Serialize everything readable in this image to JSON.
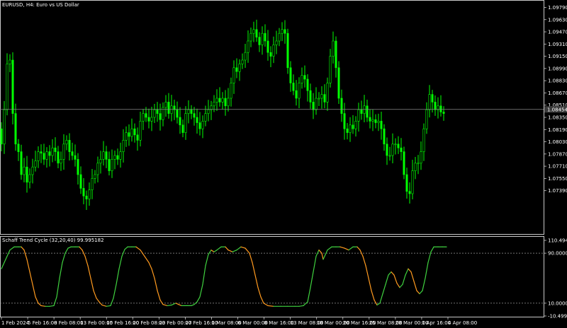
{
  "chart_data": [
    {
      "type": "candlestick",
      "symbol": "EURUSD",
      "timeframe": "H4",
      "title": "EURUSD, H4:  Euro vs US Dollar",
      "ylim": [
        1.0685,
        1.0985
      ],
      "y_ticks": [
        "1.09790",
        "1.09630",
        "1.09470",
        "1.09310",
        "1.09150",
        "1.08990",
        "1.08830",
        "1.08670",
        "1.08510",
        "1.08350",
        "1.08190",
        "1.08030",
        "1.07870",
        "1.07710",
        "1.07550",
        "1.07390"
      ],
      "current_price": 1.08454,
      "current_price_label": "1.08454",
      "x_ticks": [
        "1 Feb 2024",
        "5 Feb 16:00",
        "8 Feb 08:00",
        "13 Feb 00:00",
        "15 Feb 16:00",
        "20 Feb 08:00",
        "23 Feb 00:00",
        "27 Feb 16:00",
        "1 Mar 08:00",
        "6 Mar 00:00",
        "8 Mar 16:00",
        "13 Mar 08:00",
        "18 Mar 00:00",
        "20 Mar 16:00",
        "25 Mar 08:00",
        "28 Mar 00:00",
        "1 Apr 16:00",
        "4 Apr 08:00"
      ],
      "candle_color": "#00ff00",
      "close_path": [
        [
          0,
          1.082
        ],
        [
          4,
          1.08
        ],
        [
          8,
          1.0845
        ],
        [
          12,
          1.0905
        ],
        [
          16,
          1.091
        ],
        [
          20,
          1.084
        ],
        [
          24,
          1.08
        ],
        [
          28,
          1.079
        ],
        [
          32,
          1.076
        ],
        [
          36,
          1.077
        ],
        [
          40,
          1.075
        ],
        [
          44,
          1.076
        ],
        [
          48,
          1.077
        ],
        [
          52,
          1.0778
        ],
        [
          56,
          1.079
        ],
        [
          60,
          1.0788
        ],
        [
          64,
          1.078
        ],
        [
          68,
          1.079
        ],
        [
          72,
          1.0785
        ],
        [
          76,
          1.0795
        ],
        [
          80,
          1.079
        ],
        [
          84,
          1.0775
        ],
        [
          88,
          1.078
        ],
        [
          92,
          1.08
        ],
        [
          96,
          1.0805
        ],
        [
          100,
          1.079
        ],
        [
          104,
          1.0785
        ],
        [
          108,
          1.078
        ],
        [
          112,
          1.076
        ],
        [
          116,
          1.0742
        ],
        [
          120,
          1.0732
        ],
        [
          124,
          1.0728
        ],
        [
          128,
          1.074
        ],
        [
          132,
          1.0755
        ],
        [
          136,
          1.076
        ],
        [
          140,
          1.0775
        ],
        [
          144,
          1.078
        ],
        [
          148,
          1.079
        ],
        [
          152,
          1.078
        ],
        [
          156,
          1.0765
        ],
        [
          160,
          1.078
        ],
        [
          164,
          1.0785
        ],
        [
          168,
          1.078
        ],
        [
          172,
          1.079
        ],
        [
          176,
          1.0805
        ],
        [
          180,
          1.0815
        ],
        [
          184,
          1.081
        ],
        [
          188,
          1.082
        ],
        [
          192,
          1.0812
        ],
        [
          196,
          1.0805
        ],
        [
          200,
          1.083
        ],
        [
          204,
          1.084
        ],
        [
          208,
          1.0835
        ],
        [
          212,
          1.083
        ],
        [
          216,
          1.0835
        ],
        [
          220,
          1.0845
        ],
        [
          224,
          1.084
        ],
        [
          228,
          1.0832
        ],
        [
          232,
          1.0848
        ],
        [
          236,
          1.0855
        ],
        [
          240,
          1.084
        ],
        [
          244,
          1.085
        ],
        [
          248,
          1.0845
        ],
        [
          252,
          1.0835
        ],
        [
          256,
          1.0825
        ],
        [
          260,
          1.0815
        ],
        [
          264,
          1.084
        ],
        [
          268,
          1.0845
        ],
        [
          272,
          1.084
        ],
        [
          276,
          1.0835
        ],
        [
          280,
          1.0828
        ],
        [
          284,
          1.082
        ],
        [
          288,
          1.083
        ],
        [
          292,
          1.084
        ],
        [
          296,
          1.0845
        ],
        [
          300,
          1.085
        ],
        [
          304,
          1.0855
        ],
        [
          308,
          1.086
        ],
        [
          312,
          1.0855
        ],
        [
          316,
          1.086
        ],
        [
          320,
          1.085
        ],
        [
          324,
          1.086
        ],
        [
          328,
          1.088
        ],
        [
          332,
          1.09
        ],
        [
          336,
          1.0895
        ],
        [
          340,
          1.0905
        ],
        [
          344,
          1.091
        ],
        [
          348,
          1.092
        ],
        [
          352,
          1.0935
        ],
        [
          356,
          1.0945
        ],
        [
          360,
          1.095
        ],
        [
          364,
          1.094
        ],
        [
          368,
          1.093
        ],
        [
          372,
          1.0945
        ],
        [
          376,
          1.0935
        ],
        [
          380,
          1.092
        ],
        [
          384,
          1.0915
        ],
        [
          388,
          1.093
        ],
        [
          392,
          1.0935
        ],
        [
          396,
          1.0945
        ],
        [
          400,
          1.095
        ],
        [
          404,
          1.0945
        ],
        [
          408,
          1.09
        ],
        [
          412,
          1.088
        ],
        [
          416,
          1.087
        ],
        [
          420,
          1.086
        ],
        [
          424,
          1.088
        ],
        [
          428,
          1.089
        ],
        [
          432,
          1.0885
        ],
        [
          436,
          1.087
        ],
        [
          440,
          1.0855
        ],
        [
          444,
          1.0845
        ],
        [
          448,
          1.086
        ],
        [
          452,
          1.086
        ],
        [
          456,
          1.0865
        ],
        [
          460,
          1.0855
        ],
        [
          464,
          1.088
        ],
        [
          468,
          1.0915
        ],
        [
          472,
          1.0935
        ],
        [
          476,
          1.09
        ],
        [
          480,
          1.086
        ],
        [
          484,
          1.084
        ],
        [
          488,
          1.082
        ],
        [
          492,
          1.0815
        ],
        [
          496,
          1.0825
        ],
        [
          500,
          1.082
        ],
        [
          504,
          1.083
        ],
        [
          508,
          1.0845
        ],
        [
          512,
          1.084
        ],
        [
          516,
          1.085
        ],
        [
          520,
          1.0835
        ],
        [
          524,
          1.083
        ],
        [
          528,
          1.0832
        ],
        [
          532,
          1.0828
        ],
        [
          536,
          1.083
        ],
        [
          540,
          1.082
        ],
        [
          544,
          1.08
        ],
        [
          548,
          1.0785
        ],
        [
          552,
          1.0785
        ],
        [
          556,
          1.08
        ],
        [
          560,
          1.08
        ],
        [
          564,
          1.0795
        ],
        [
          568,
          1.079
        ],
        [
          572,
          1.076
        ],
        [
          576,
          1.0738
        ],
        [
          580,
          1.0735
        ],
        [
          584,
          1.0765
        ],
        [
          588,
          1.0775
        ],
        [
          592,
          1.0775
        ],
        [
          596,
          1.079
        ],
        [
          600,
          1.082
        ],
        [
          604,
          1.0845
        ],
        [
          608,
          1.0865
        ],
        [
          612,
          1.0855
        ],
        [
          616,
          1.0845
        ],
        [
          620,
          1.085
        ],
        [
          624,
          1.0842
        ],
        [
          628,
          1.084
        ]
      ]
    },
    {
      "type": "line",
      "title": "Schaff Trend Cycle (32,20,40) 99.995182",
      "ylim": [
        -10.495,
        110.495
      ],
      "y_ticks": [
        "110.494582",
        "90.000000",
        "10.000000",
        "-10.499424"
      ],
      "levels": [
        90,
        10
      ],
      "rising_color": "#3fd13f",
      "falling_color": "#ff9a1f",
      "series": [
        {
          "points": [
            [
              0,
              65
            ],
            [
              4,
              75
            ],
            [
              8,
              85
            ],
            [
              12,
              95
            ],
            [
              18,
              100
            ],
            [
              24,
              100
            ],
            [
              28,
              100
            ],
            [
              32,
              95
            ],
            [
              36,
              80
            ],
            [
              40,
              60
            ],
            [
              44,
              40
            ],
            [
              48,
              20
            ],
            [
              52,
              10
            ],
            [
              56,
              6
            ],
            [
              62,
              5
            ],
            [
              68,
              5
            ],
            [
              74,
              6
            ],
            [
              78,
              20
            ],
            [
              82,
              50
            ],
            [
              86,
              75
            ],
            [
              90,
              90
            ],
            [
              94,
              98
            ],
            [
              98,
              100
            ],
            [
              104,
              100
            ],
            [
              110,
              100
            ],
            [
              114,
              95
            ],
            [
              118,
              85
            ],
            [
              122,
              70
            ],
            [
              126,
              50
            ],
            [
              130,
              30
            ],
            [
              134,
              18
            ],
            [
              138,
              12
            ],
            [
              142,
              7
            ],
            [
              148,
              5
            ],
            [
              154,
              6
            ],
            [
              158,
              18
            ],
            [
              162,
              40
            ],
            [
              166,
              65
            ],
            [
              170,
              85
            ],
            [
              174,
              96
            ],
            [
              178,
              100
            ],
            [
              184,
              100
            ],
            [
              190,
              100
            ],
            [
              196,
              95
            ],
            [
              202,
              85
            ],
            [
              208,
              75
            ],
            [
              212,
              65
            ],
            [
              216,
              50
            ],
            [
              220,
              30
            ],
            [
              224,
              15
            ],
            [
              228,
              8
            ],
            [
              234,
              6
            ],
            [
              240,
              7
            ],
            [
              246,
              10
            ],
            [
              250,
              8
            ],
            [
              254,
              6
            ],
            [
              262,
              6
            ],
            [
              268,
              6
            ],
            [
              272,
              8
            ],
            [
              276,
              12
            ],
            [
              280,
              20
            ],
            [
              284,
              40
            ],
            [
              288,
              70
            ],
            [
              292,
              88
            ],
            [
              296,
              95
            ],
            [
              300,
              92
            ],
            [
              304,
              95
            ],
            [
              310,
              100
            ],
            [
              316,
              100
            ],
            [
              320,
              95
            ],
            [
              326,
              92
            ],
            [
              332,
              95
            ],
            [
              338,
              100
            ],
            [
              344,
              98
            ],
            [
              350,
              90
            ],
            [
              354,
              75
            ],
            [
              358,
              55
            ],
            [
              362,
              35
            ],
            [
              366,
              20
            ],
            [
              370,
              10
            ],
            [
              376,
              6
            ],
            [
              384,
              5
            ],
            [
              394,
              5
            ],
            [
              404,
              5
            ],
            [
              414,
              5
            ],
            [
              420,
              5
            ],
            [
              426,
              6
            ],
            [
              432,
              12
            ],
            [
              436,
              35
            ],
            [
              440,
              60
            ],
            [
              444,
              85
            ],
            [
              448,
              95
            ],
            [
              452,
              90
            ],
            [
              454,
              80
            ],
            [
              456,
              85
            ],
            [
              460,
              95
            ],
            [
              466,
              100
            ],
            [
              472,
              100
            ],
            [
              478,
              100
            ],
            [
              484,
              98
            ],
            [
              490,
              95
            ],
            [
              496,
              100
            ],
            [
              502,
              100
            ],
            [
              506,
              95
            ],
            [
              510,
              85
            ],
            [
              514,
              70
            ],
            [
              518,
              50
            ],
            [
              522,
              30
            ],
            [
              526,
              15
            ],
            [
              530,
              7
            ],
            [
              534,
              10
            ],
            [
              538,
              25
            ],
            [
              542,
              40
            ],
            [
              546,
              55
            ],
            [
              550,
              60
            ],
            [
              554,
              55
            ],
            [
              558,
              42
            ],
            [
              562,
              35
            ],
            [
              566,
              40
            ],
            [
              570,
              55
            ],
            [
              574,
              65
            ],
            [
              578,
              60
            ],
            [
              582,
              45
            ],
            [
              586,
              30
            ],
            [
              590,
              25
            ],
            [
              594,
              30
            ],
            [
              598,
              50
            ],
            [
              602,
              75
            ],
            [
              606,
              92
            ],
            [
              610,
              100
            ],
            [
              616,
              100
            ],
            [
              622,
              100
            ],
            [
              628,
              100
            ]
          ]
        }
      ]
    }
  ]
}
